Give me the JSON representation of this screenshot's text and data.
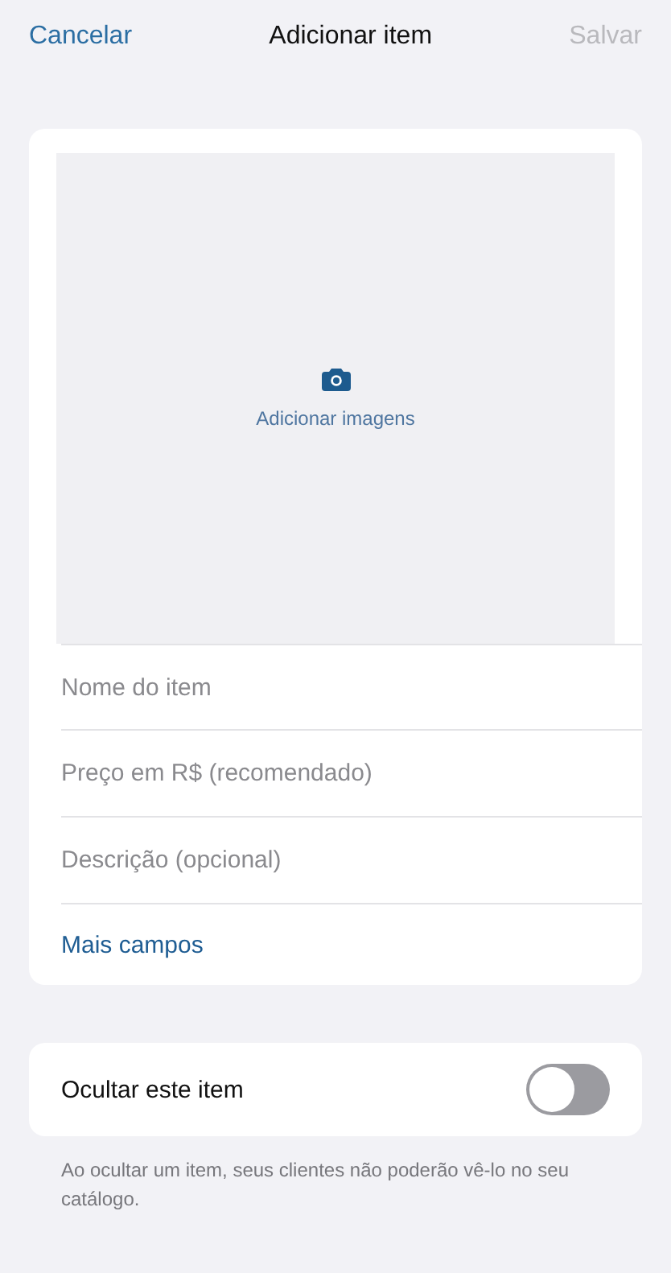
{
  "nav": {
    "cancel": "Cancelar",
    "title": "Adicionar item",
    "save": {
      "label": "Salvar",
      "disabled": true
    }
  },
  "images": {
    "label": "Adicionar imagens"
  },
  "fields": [
    {
      "placeholder": "Nome do item"
    },
    {
      "placeholder": "Preço em R$ (recomendado)"
    },
    {
      "placeholder": "Descrição (opcional)"
    }
  ],
  "more_fields": "Mais campos",
  "hide": {
    "label": "Ocultar este item",
    "on": false
  },
  "hide_note": "Ao ocultar um item, seus clientes não poderão vê-lo no seu catálogo."
}
